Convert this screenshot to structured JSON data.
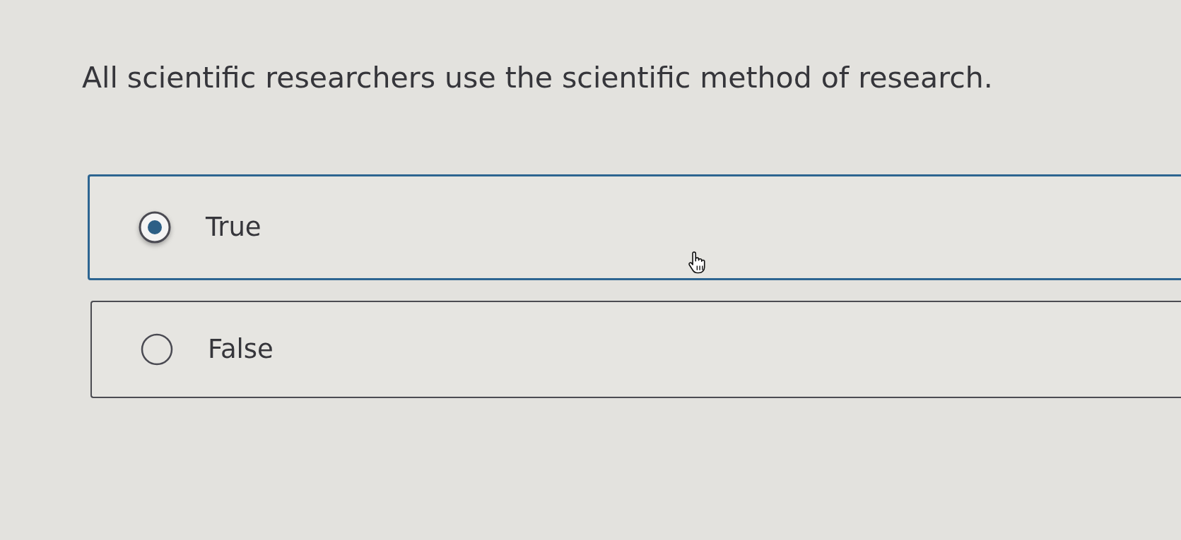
{
  "question": "All scientific researchers use the scientific method of research.",
  "options": [
    {
      "label": "True",
      "selected": true
    },
    {
      "label": "False",
      "selected": false
    }
  ]
}
